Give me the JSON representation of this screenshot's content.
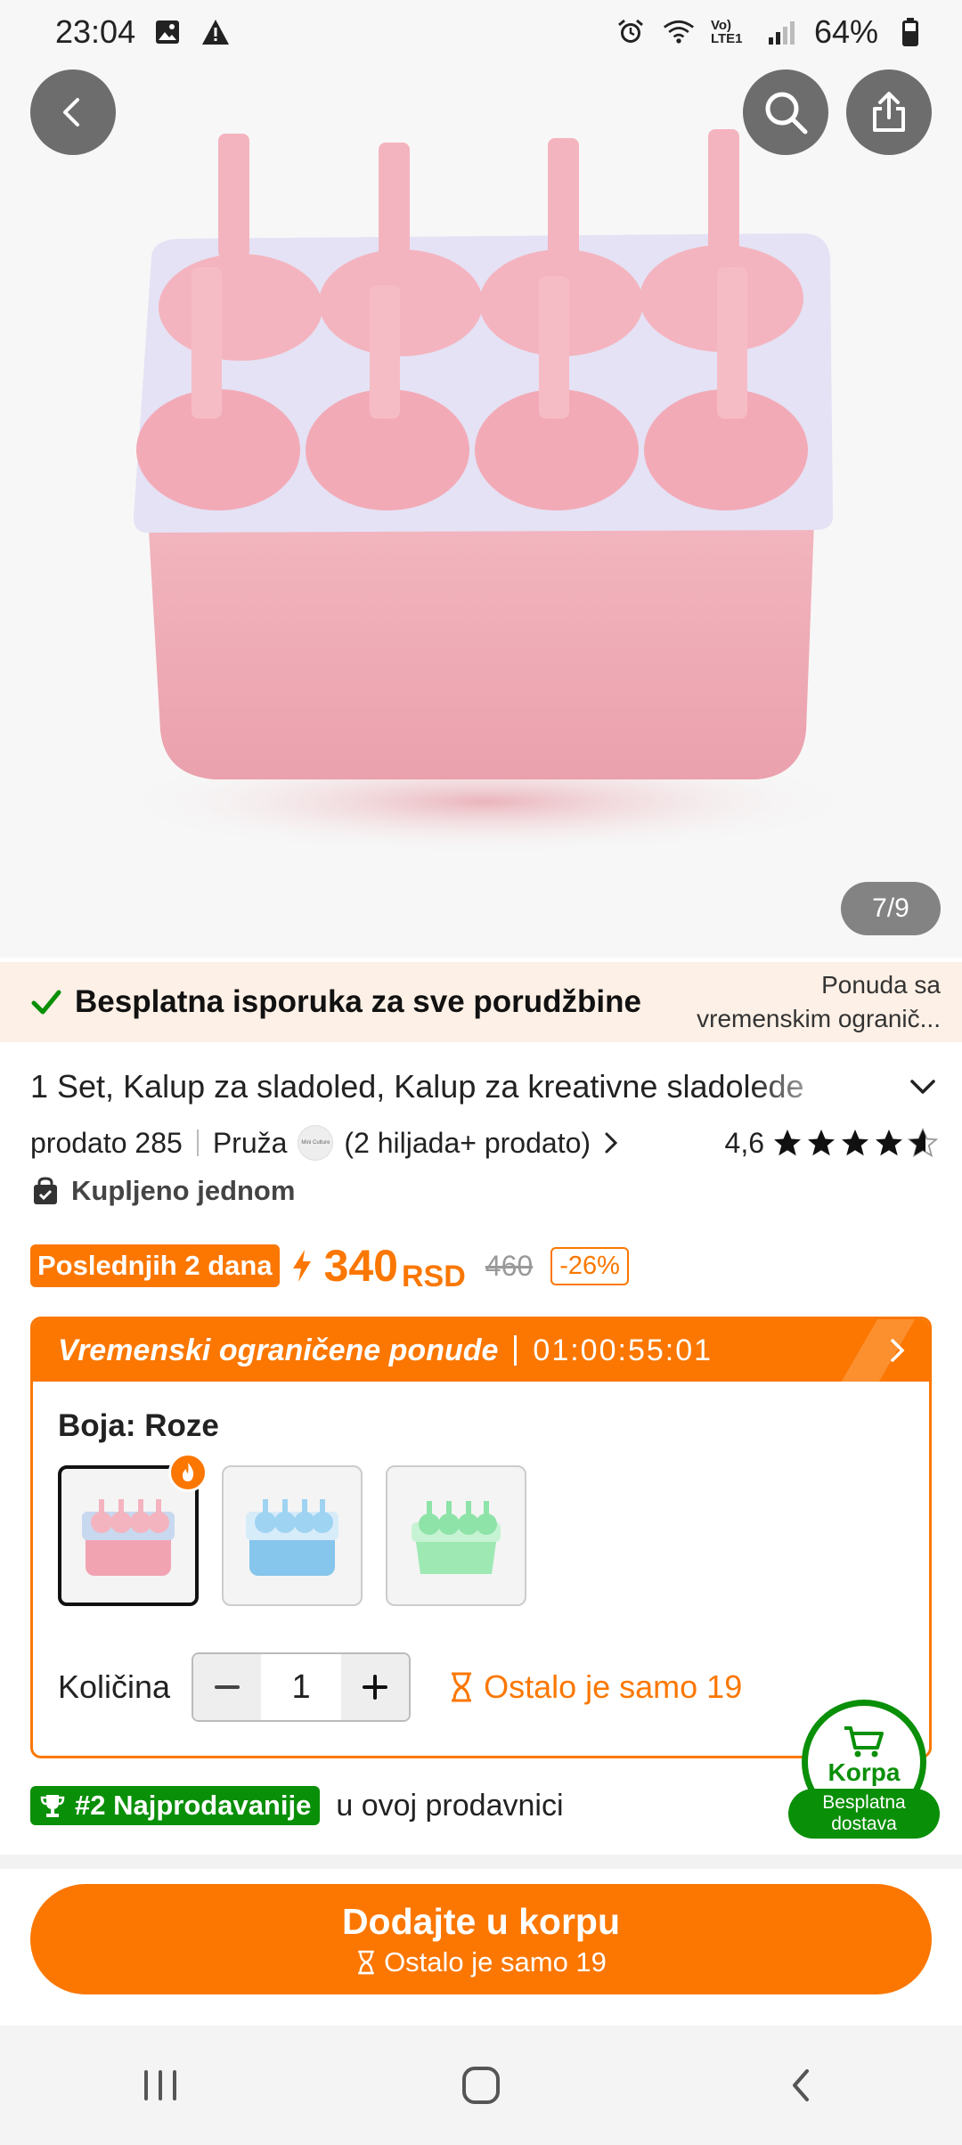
{
  "status_bar": {
    "time": "23:04",
    "battery": "64%",
    "network": "Vo) LTE1"
  },
  "gallery": {
    "counter": "7/9"
  },
  "delivery": {
    "text": "Besplatna isporuka za sve porudžbine",
    "offer_line1": "Ponuda sa",
    "offer_line2": "vremenskim ogranič..."
  },
  "product": {
    "title": "1 Set, Kalup za sladoled, Kalup za kreativne sladolede",
    "sold": "prodato 285",
    "provides": "Pruža",
    "shop_logo_text": "Mini Culture",
    "shop_sold": "(2 hiljada+ prodato)",
    "rating": "4,6",
    "bought": "Kupljeno jednom"
  },
  "price": {
    "promo": "Poslednjih 2 dana",
    "amount": "340",
    "currency": "RSD",
    "old": "460",
    "discount": "-26%"
  },
  "offer": {
    "label": "Vremenski ograničene ponude",
    "timer": "01:00:55:01",
    "color_label": "Boja: Roze",
    "swatches": [
      {
        "name": "Roze",
        "color": "#f4a9b8"
      },
      {
        "name": "Plava",
        "color": "#8ecbef"
      },
      {
        "name": "Zelena",
        "color": "#8ee3a8"
      }
    ],
    "qty_label": "Količina",
    "qty_value": "1",
    "stock": "Ostalo je samo 19"
  },
  "cart": {
    "label": "Korpa",
    "tag": "Besplatna dostava"
  },
  "bestseller": {
    "badge": "#2 Najprodavanije",
    "text": "u ovoj prodavnici"
  },
  "cta": {
    "main": "Dodajte u korpu",
    "sub": "Ostalo je samo 19"
  },
  "colors": {
    "accent": "#fb7701",
    "green": "#0a8f08",
    "banner": "#fdf0e6"
  }
}
